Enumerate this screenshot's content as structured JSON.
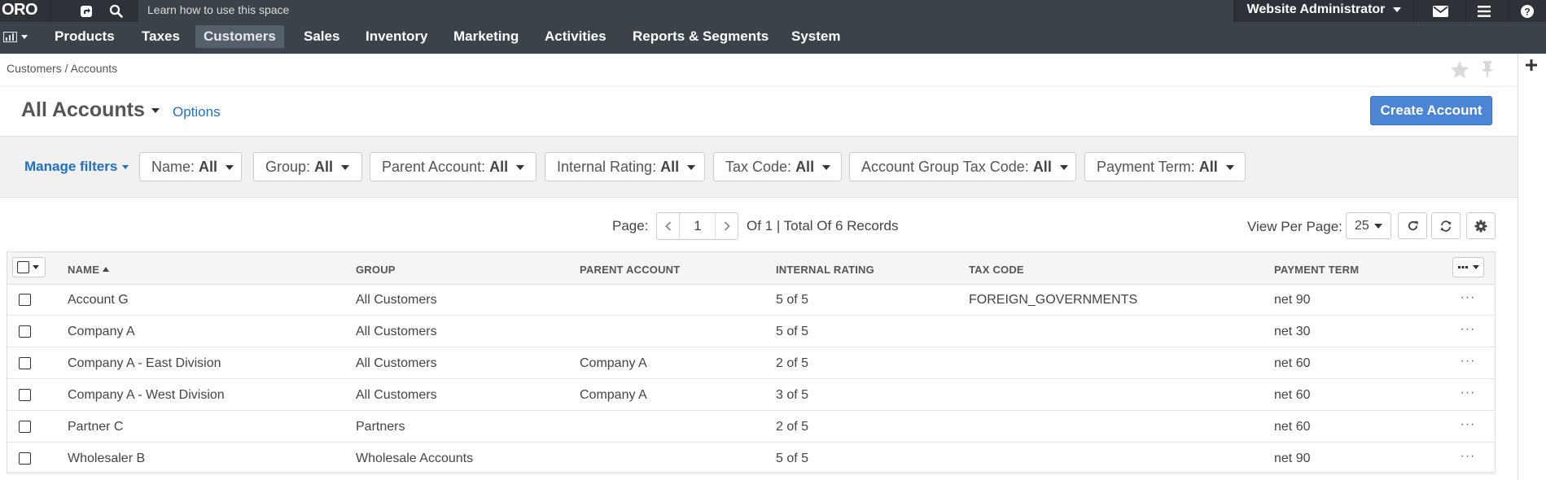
{
  "topbar": {
    "logo": "ORO",
    "help_text": "Learn how to use this space",
    "user": "Website Administrator",
    "icons": [
      "share-icon",
      "search-icon",
      "envelope-icon",
      "hamburger-icon",
      "help-icon"
    ]
  },
  "menu": {
    "items": [
      "Products",
      "Taxes",
      "Customers",
      "Sales",
      "Inventory",
      "Marketing",
      "Activities",
      "Reports & Segments",
      "System"
    ],
    "active": "Customers"
  },
  "breadcrumb": {
    "parent": "Customers",
    "separator": "/",
    "current": "Accounts"
  },
  "page": {
    "title": "All Accounts",
    "options": "Options",
    "create_button": "Create Account"
  },
  "filters": {
    "manage": "Manage filters",
    "items": [
      {
        "label": "Name:",
        "value": "All"
      },
      {
        "label": "Group:",
        "value": "All"
      },
      {
        "label": "Parent Account:",
        "value": "All"
      },
      {
        "label": "Internal Rating:",
        "value": "All"
      },
      {
        "label": "Tax Code:",
        "value": "All"
      },
      {
        "label": "Account Group Tax Code:",
        "value": "All"
      },
      {
        "label": "Payment Term:",
        "value": "All"
      }
    ]
  },
  "pager": {
    "label": "Page:",
    "current": "1",
    "total_text": "Of 1 | Total Of 6 Records",
    "view_per_page_label": "View Per Page:",
    "per_page": "25"
  },
  "grid": {
    "columns": [
      "Name",
      "Group",
      "Parent Account",
      "Internal Rating",
      "Tax Code",
      "Payment Term"
    ],
    "sort": {
      "column": "Name",
      "direction": "asc"
    },
    "rows": [
      [
        "Account G",
        "All Customers",
        "",
        "5 of 5",
        "FOREIGN_GOVERNMENTS",
        "net 90"
      ],
      [
        "Company A",
        "All Customers",
        "",
        "5 of 5",
        "",
        "net 30"
      ],
      [
        "Company A - East Division",
        "All Customers",
        "Company A",
        "2 of 5",
        "",
        "net 60"
      ],
      [
        "Company A - West Division",
        "All Customers",
        "Company A",
        "3 of 5",
        "",
        "net 60"
      ],
      [
        "Partner C",
        "Partners",
        "",
        "2 of 5",
        "",
        "net 60"
      ],
      [
        "Wholesaler B",
        "Wholesale Accounts",
        "",
        "5 of 5",
        "",
        "net 90"
      ]
    ],
    "row_action": "···"
  },
  "colors": {
    "topbar": "#2d3238",
    "menubar": "#3c4249",
    "active_menu": "#566069",
    "primary_button": "#4c84d6",
    "link": "#1f6fc7",
    "filter_bg": "#f1f1f1"
  }
}
